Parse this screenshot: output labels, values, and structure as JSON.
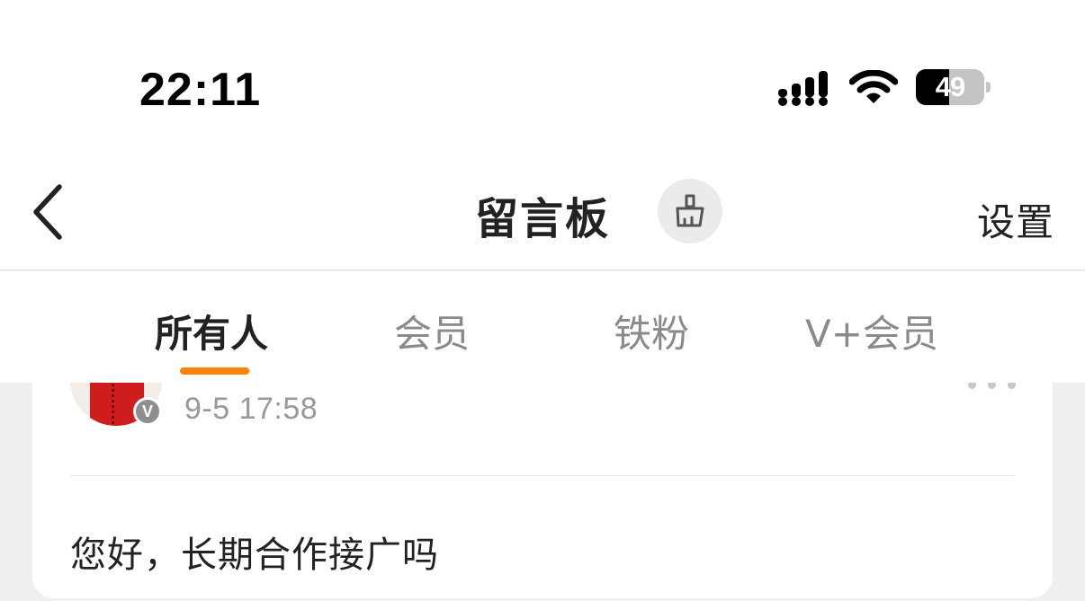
{
  "status_bar": {
    "time": "22:11",
    "battery_level": "49",
    "battery_percent": 49,
    "icons": [
      "signal-icon",
      "wifi-icon",
      "battery-icon"
    ]
  },
  "nav": {
    "back_icon": "chevron-left-icon",
    "title": "留言板",
    "clean_icon": "broom-icon",
    "settings_label": "设置"
  },
  "tabs": [
    {
      "label": "所有人",
      "active": true
    },
    {
      "label": "会员",
      "active": false
    },
    {
      "label": "铁粉",
      "active": false
    },
    {
      "label": "V+会员",
      "active": false
    }
  ],
  "colors": {
    "accent": "#ff8200",
    "background": "#efefef",
    "text_primary": "#222222",
    "text_secondary": "#8a8a8a"
  },
  "messages": [
    {
      "time": "9-5 17:58",
      "verified_badge": "V",
      "text": "您好，长期合作接广吗",
      "more_icon": "more-dots-icon"
    }
  ]
}
